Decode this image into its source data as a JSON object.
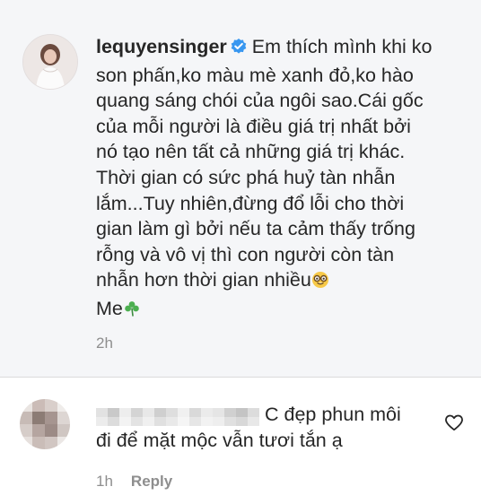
{
  "caption": {
    "username": "lequyensinger",
    "text_lines": [
      "Em thích mình khi ko",
      "son phấn,ko màu mè xanh đỏ,ko hào",
      "quang sáng chói của ngôi sao.Cái gốc",
      "của mỗi người là điều giá trị nhất bởi",
      "nó tạo nên tất cả những giá trị khác.",
      "Thời gian có sức phá huỷ tàn nhẫn",
      "lắm...Tuy nhiên,đừng đổ lỗi cho thời",
      "gian làm gì bởi nếu ta cảm thấy trống",
      "rỗng và vô vị thì con người còn tàn",
      "nhẫn hơn thời gian nhiều"
    ],
    "signature": "Me",
    "time": "2h"
  },
  "comment": {
    "text_line1": "C đẹp phun môi",
    "text_line2": "đi để mặt mộc vẫn tươi tắn ạ",
    "time": "1h",
    "reply_label": "Reply"
  },
  "colors": {
    "caption_background": "#f5f6f8",
    "verified_blue": "#3897f0",
    "meta_gray": "#8e8e8e"
  },
  "icons": {
    "verified": "verified-badge-icon",
    "glasses_emoji": "nerd-face-emoji",
    "shamrock_emoji": "shamrock-emoji",
    "like": "heart-outline-icon"
  }
}
